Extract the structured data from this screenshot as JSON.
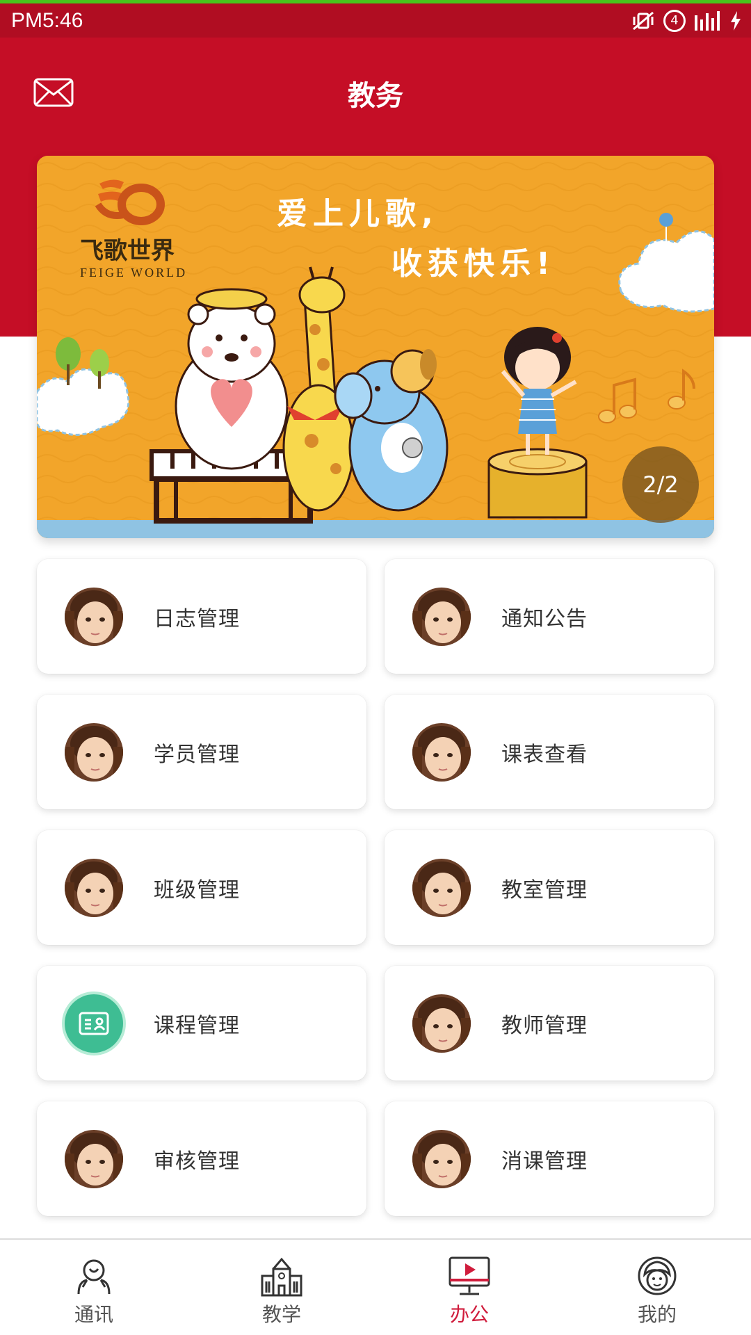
{
  "status_bar": {
    "time": "PM5:46",
    "notification_count": "4"
  },
  "header": {
    "title": "教务"
  },
  "banner": {
    "counter": "2/2",
    "brand_cn": "飞歌世界",
    "brand_en": "FEIGE WORLD",
    "slogan_line1": "爱上儿歌,",
    "slogan_line2": "收获快乐!"
  },
  "menu": {
    "items": [
      {
        "label": "日志管理",
        "icon": "avatar-girl"
      },
      {
        "label": "通知公告",
        "icon": "avatar-girl"
      },
      {
        "label": "学员管理",
        "icon": "avatar-girl"
      },
      {
        "label": "课表查看",
        "icon": "avatar-girl"
      },
      {
        "label": "班级管理",
        "icon": "avatar-girl"
      },
      {
        "label": "教室管理",
        "icon": "avatar-girl"
      },
      {
        "label": "课程管理",
        "icon": "id-card-icon"
      },
      {
        "label": "教师管理",
        "icon": "avatar-girl"
      },
      {
        "label": "审核管理",
        "icon": "avatar-girl"
      },
      {
        "label": "消课管理",
        "icon": "avatar-girl"
      }
    ]
  },
  "tabbar": {
    "items": [
      {
        "label": "通讯",
        "icon": "contacts-icon"
      },
      {
        "label": "教学",
        "icon": "school-icon"
      },
      {
        "label": "办公",
        "icon": "monitor-play-icon",
        "active": true
      },
      {
        "label": "我的",
        "icon": "user-face-icon"
      }
    ]
  },
  "colors": {
    "header_red": "#c50e26",
    "status_red": "#b00d22",
    "active_tab": "#d01c3c",
    "course_icon_green": "#3ebd93",
    "banner_orange": "#f2a52a"
  }
}
